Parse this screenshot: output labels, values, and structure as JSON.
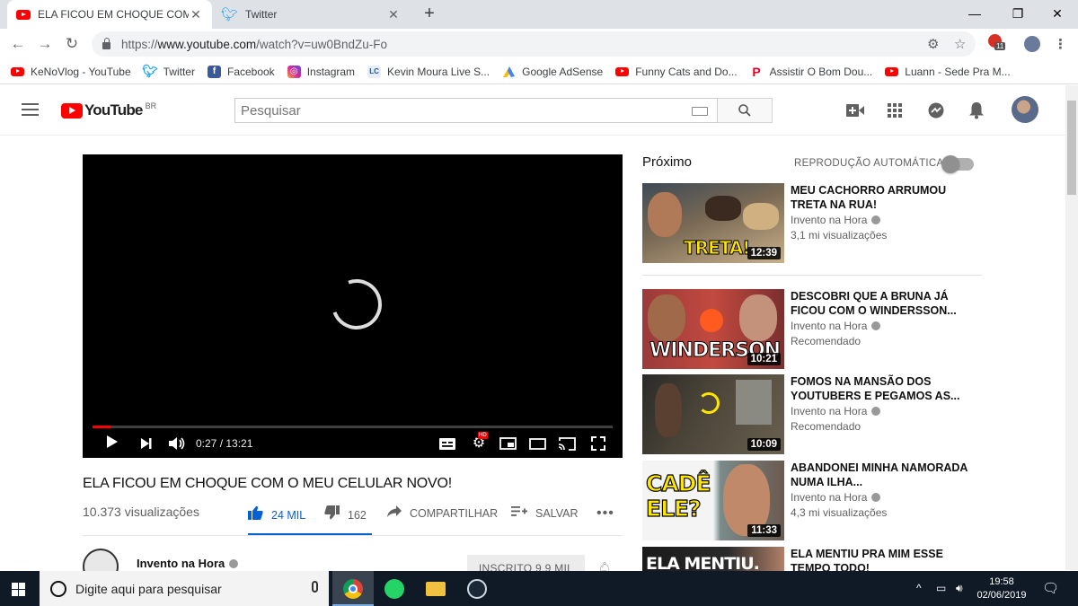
{
  "browser": {
    "tabs": [
      {
        "title": "ELA FICOU EM CHOQUE COM O",
        "active": true
      },
      {
        "title": "Twitter",
        "active": false
      }
    ],
    "url": {
      "scheme": "https://",
      "host": "www.youtube.com",
      "path": "/watch?v=uw0BndZu-Fo"
    },
    "extension_badge": "11"
  },
  "bookmarks": [
    {
      "label": "KeNoVlog - YouTube",
      "icon": "youtube-icon"
    },
    {
      "label": "Twitter",
      "icon": "twitter-icon"
    },
    {
      "label": "Facebook",
      "icon": "facebook-icon"
    },
    {
      "label": "Instagram",
      "icon": "instagram-icon"
    },
    {
      "label": "Kevin Moura Live S...",
      "icon": "lc-icon",
      "icon_text": "LC"
    },
    {
      "label": "Google AdSense",
      "icon": "adsense-icon"
    },
    {
      "label": "Funny Cats and Do...",
      "icon": "youtube-icon"
    },
    {
      "label": "Assistir O Bom Dou...",
      "icon": "pinterest-icon",
      "icon_text": "P"
    },
    {
      "label": "Luann - Sede Pra M...",
      "icon": "youtube-icon"
    }
  ],
  "youtube": {
    "logo_text": "YouTube",
    "region": "BR",
    "search_placeholder": "Pesquisar"
  },
  "player": {
    "time": "0:27 / 13:21",
    "progress": 0.034
  },
  "video": {
    "title": "ELA FICOU EM CHOQUE COM O MEU CELULAR NOVO!",
    "views": "10.373 visualizações",
    "likes": "24 MIL",
    "dislikes": "162",
    "share_label": "COMPARTILHAR",
    "save_label": "SALVAR",
    "channel": "Invento na Hora",
    "subscribe_label": "INSCRITO",
    "subscriber_count": "9,9 MIL"
  },
  "sidebar": {
    "next_label": "Próximo",
    "autoplay_label": "REPRODUÇÃO AUTOMÁTICA",
    "videos": [
      {
        "title": "MEU CACHORRO ARRUMOU TRETA NA RUA!",
        "channel": "Invento na Hora",
        "meta": "3,1 mi visualizações",
        "duration": "12:39",
        "thumb_text": "TRETA!"
      },
      {
        "title": "DESCOBRI QUE A BRUNA JÁ FICOU COM O WINDERSSON...",
        "channel": "Invento na Hora",
        "meta": "Recomendado",
        "duration": "10:21",
        "thumb_text": "WINDERSON"
      },
      {
        "title": "FOMOS NA MANSÃO DOS YOUTUBERS E PEGAMOS AS...",
        "channel": "Invento na Hora",
        "meta": "Recomendado",
        "duration": "10:09",
        "thumb_text": ""
      },
      {
        "title": "ABANDONEI MINHA NAMORADA NUMA ILHA...",
        "channel": "Invento na Hora",
        "meta": "4,3 mi visualizações",
        "duration": "11:33",
        "thumb_text": "CADÊ ELE?"
      },
      {
        "title": "ELA MENTIU PRA MIM ESSE TEMPO TODO!",
        "channel": "",
        "meta": "",
        "duration": "",
        "thumb_text": "ELA MENTIU."
      }
    ]
  },
  "taskbar": {
    "search_placeholder": "Digite aqui para pesquisar",
    "time": "19:58",
    "date": "02/06/2019"
  }
}
